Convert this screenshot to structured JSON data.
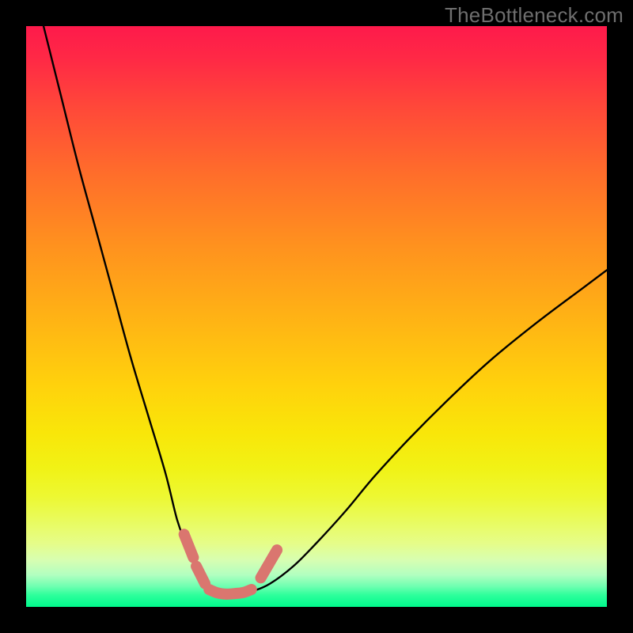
{
  "watermark": "TheBottleneck.com",
  "colors": {
    "page_bg": "#000000",
    "watermark": "#6e6e6e",
    "curve": "#000000",
    "ridge": "#da766f"
  },
  "chart_data": {
    "type": "line",
    "title": "",
    "xlabel": "",
    "ylabel": "",
    "xlim": [
      0,
      100
    ],
    "ylim": [
      0,
      100
    ],
    "grid": false,
    "legend": false,
    "series": [
      {
        "name": "bottleneck-curve",
        "x": [
          3,
          6,
          9,
          12,
          15,
          18,
          21,
          24,
          26,
          27.5,
          29,
          30.5,
          32,
          33.5,
          35,
          37,
          39,
          42,
          46,
          50,
          55,
          60,
          66,
          73,
          80,
          88,
          96,
          100
        ],
        "y": [
          100,
          88,
          76,
          65,
          54,
          43,
          33,
          23,
          15,
          11,
          7.5,
          5,
          3.3,
          2.5,
          2.3,
          2.3,
          2.7,
          4,
          7,
          11,
          16.5,
          22.5,
          29,
          36,
          42.5,
          49,
          55,
          58
        ]
      }
    ],
    "annotations": [
      {
        "name": "ridge-segment-1",
        "type": "line",
        "x": [
          27.2,
          28.8
        ],
        "y": [
          12.5,
          8.5
        ]
      },
      {
        "name": "ridge-segment-2",
        "type": "line",
        "x": [
          29.3,
          30.8
        ],
        "y": [
          7.0,
          4.0
        ]
      },
      {
        "name": "ridge-bottom",
        "type": "line",
        "x": [
          31.5,
          33,
          34.5,
          36,
          37.5,
          38.8
        ],
        "y": [
          3.0,
          2.4,
          2.2,
          2.3,
          2.5,
          3.0
        ]
      },
      {
        "name": "ridge-segment-4",
        "type": "line",
        "x": [
          40.4,
          43.2
        ],
        "y": [
          5.0,
          9.8
        ]
      }
    ]
  }
}
